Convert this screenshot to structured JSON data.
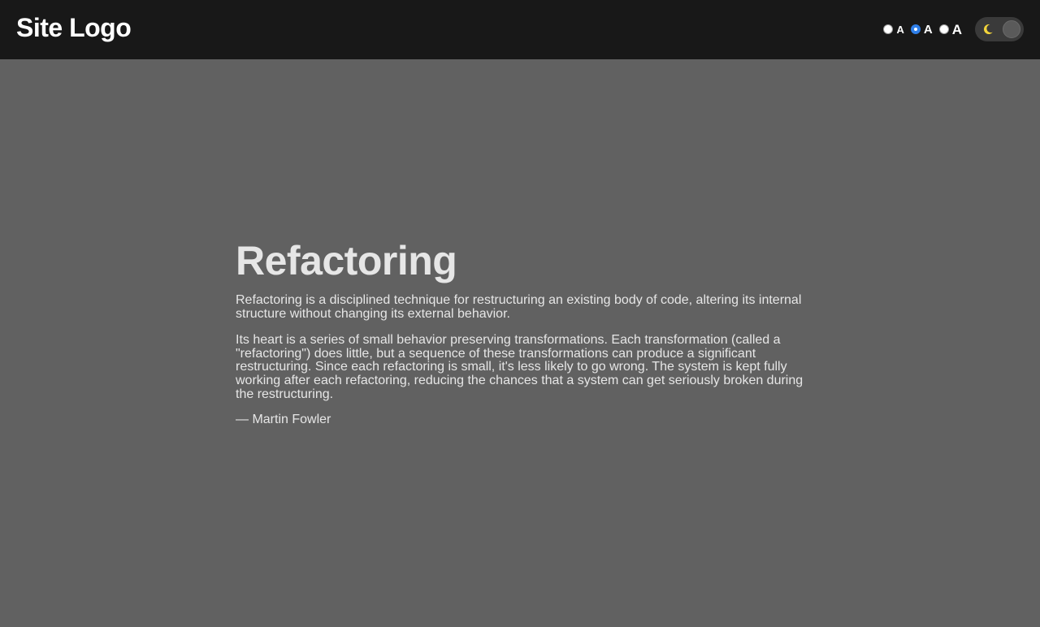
{
  "header": {
    "logo": "Site Logo",
    "font_size_options": [
      {
        "label": "A",
        "size": "small",
        "checked": false
      },
      {
        "label": "A",
        "size": "medium",
        "checked": true
      },
      {
        "label": "A",
        "size": "large",
        "checked": false
      }
    ],
    "theme_toggle": {
      "icon": "moon-icon",
      "mode": "dark"
    }
  },
  "article": {
    "title": "Refactoring",
    "paragraphs": [
      "Refactoring is a disciplined technique for restructuring an existing body of code, altering its internal structure without changing its external behavior.",
      "Its heart is a series of small behavior preserving transformations. Each transformation (called a \"refactoring\") does little, but a sequence of these transformations can produce a significant restructuring. Since each refactoring is small, it's less likely to go wrong. The system is kept fully working after each refactoring, reducing the chances that a system can get seriously broken during the restructuring."
    ],
    "author": "— Martin Fowler"
  },
  "colors": {
    "header_bg": "#181818",
    "page_bg": "#616161",
    "text": "#e6e6e6",
    "radio_accent": "#2f7fe8",
    "moon": "#f2d43a"
  }
}
